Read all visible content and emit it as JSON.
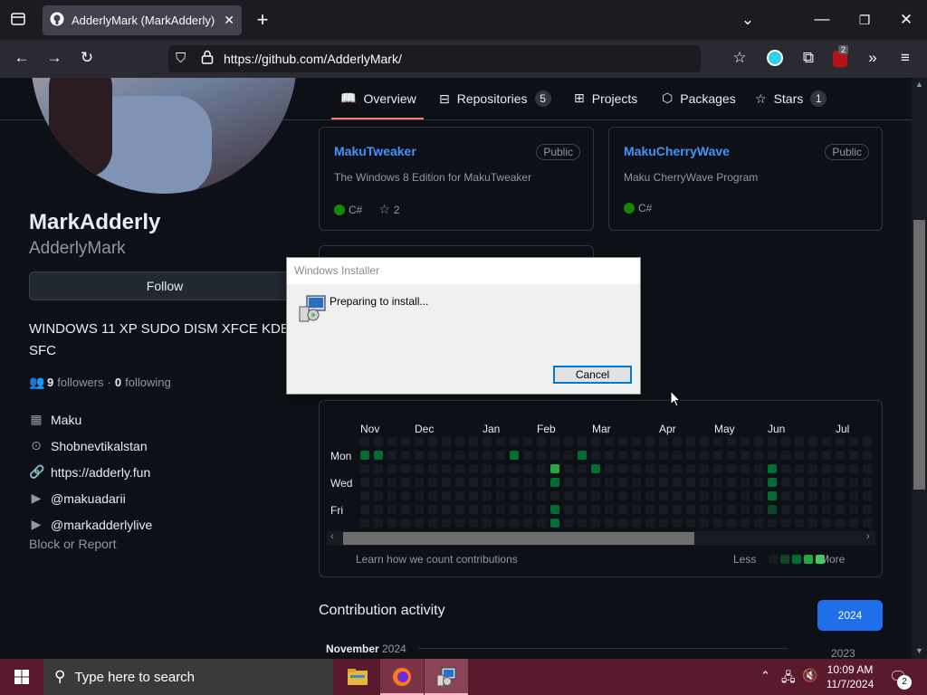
{
  "browser": {
    "tab_title": "AdderlyMark (MarkAdderly) · G",
    "url": "https://github.com/AdderlyMark/",
    "ublock_count": "2"
  },
  "nav_tabs": [
    {
      "label": "Overview",
      "count": ""
    },
    {
      "label": "Repositories",
      "count": "5"
    },
    {
      "label": "Projects",
      "count": ""
    },
    {
      "label": "Packages",
      "count": ""
    },
    {
      "label": "Stars",
      "count": "1"
    }
  ],
  "profile": {
    "name": "MarkAdderly",
    "username": "AdderlyMark",
    "follow_label": "Follow",
    "bio_line1": "WINDOWS 11 XP SUDO DISM XFCE KDE",
    "bio_line2": "SFC",
    "followers_count": "9",
    "followers_label": "followers",
    "sep": "·",
    "following_count": "0",
    "following_label": "following",
    "company": "Maku",
    "location": "Shobnevtikalstan",
    "website": "https://adderly.fun",
    "youtube1": "@makuadarii",
    "youtube2": "@markadderlylive",
    "block_label": "Block or Report"
  },
  "repos": [
    {
      "name": "MakuTweaker",
      "visibility": "Public",
      "description": "The Windows 8 Edition for MakuTweaker",
      "language": "C#",
      "stars": "2"
    },
    {
      "name": "MakuCherryWave",
      "visibility": "Public",
      "description": "Maku CherryWave Program",
      "language": "C#",
      "stars": ""
    }
  ],
  "contrib": {
    "months": [
      "Nov",
      "Dec",
      "Jan",
      "Feb",
      "Mar",
      "Apr",
      "May",
      "Jun",
      "Jul"
    ],
    "days": [
      "Mon",
      "Wed",
      "Fri"
    ],
    "learn_label": "Learn how we count contributions",
    "less_label": "Less",
    "more_label": "More",
    "activity_title": "Contribution activity",
    "year_selected": "2024",
    "year_other": "2023",
    "month_heading": "November",
    "month_heading_year": "2024"
  },
  "dialog": {
    "title": "Windows Installer",
    "message": "Preparing to install...",
    "cancel_label": "Cancel"
  },
  "taskbar": {
    "search_placeholder": "Type here to search",
    "time": "10:09 AM",
    "date": "11/7/2024",
    "notification_count": "2"
  },
  "colors": {
    "accent_link": "#4493f8",
    "csharp": "#178600",
    "selected_year": "#1f6feb",
    "contrib_levels": [
      "#161b22",
      "#0e4429",
      "#006d32",
      "#26a641",
      "#39d353"
    ]
  }
}
